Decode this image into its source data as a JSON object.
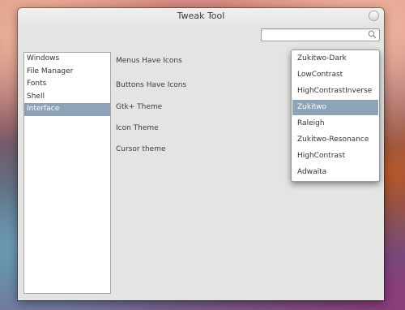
{
  "window": {
    "title": "Tweak Tool"
  },
  "search": {
    "value": "",
    "placeholder": ""
  },
  "sidebar": {
    "items": [
      {
        "label": "Windows",
        "selected": false
      },
      {
        "label": "File Manager",
        "selected": false
      },
      {
        "label": "Fonts",
        "selected": false
      },
      {
        "label": "Shell",
        "selected": false
      },
      {
        "label": "Interface",
        "selected": true
      }
    ]
  },
  "settings": {
    "menus_have_icons": "Menus Have Icons",
    "buttons_have_icons": "Buttons Have Icons",
    "gtk_theme": "Gtk+ Theme",
    "icon_theme": "Icon Theme",
    "cursor_theme": "Cursor theme"
  },
  "theme_dropdown": {
    "selected": "Zukitwo",
    "options": [
      "Zukitwo-Dark",
      "LowContrast",
      "HighContrastInverse",
      "Zukitwo",
      "Raleigh",
      "Zukitwo-Resonance",
      "HighContrast",
      "Adwaita"
    ]
  },
  "colors": {
    "selection": "#8ea3b7",
    "window_bg": "#e4e4e3"
  },
  "icons": {
    "search": "search-icon",
    "close": "close-icon"
  }
}
